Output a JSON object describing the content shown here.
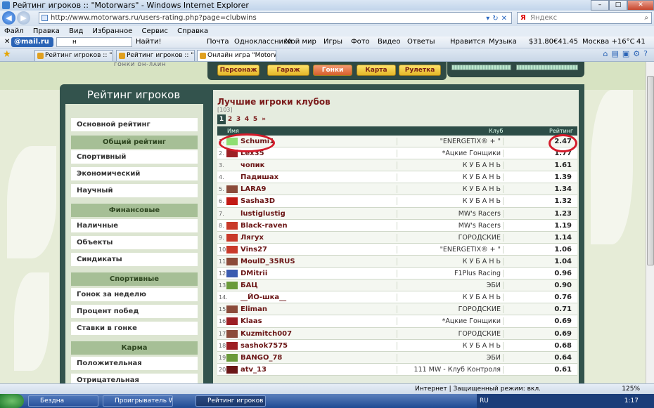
{
  "window": {
    "title": "Рейтинг игроков :: \"Motorwars\" - Windows Internet Explorer"
  },
  "address": {
    "url": "http://www.motorwars.ru/users-rating.php?page=clubwins",
    "search_placeholder": "Яндекс"
  },
  "menu": [
    "Файл",
    "Правка",
    "Вид",
    "Избранное",
    "Сервис",
    "Справка"
  ],
  "toolbar": {
    "close": "✕",
    "brand": "@mail.ru",
    "search_value": "н",
    "find": "Найти!",
    "items": [
      "Почта",
      "Одноклассники",
      "Мой мир",
      "Игры",
      "Фото",
      "Видео",
      "Ответы",
      "Нравится",
      "Музыка"
    ],
    "usd": "31.80",
    "eur": "41.45",
    "weather": "Москва +16°C",
    "counter": "41"
  },
  "tabs": [
    {
      "label": "Рейтинг игроков :: \"Moto...\""
    },
    {
      "label": "Рейтинг игроков :: \"M...\""
    },
    {
      "label": "Онлайн игра \"Motorwars\""
    }
  ],
  "site": {
    "logo_sub": "ГОНКИ ОН-ЛАЙН",
    "nav": [
      "Персонаж",
      "Гараж",
      "Гонки",
      "Карта",
      "Рулетка"
    ],
    "active_nav": "Гонки",
    "progress": [
      0.55,
      0.45
    ]
  },
  "sidebar": {
    "title": "Рейтинг игроков",
    "main": "Основной рейтинг",
    "groups": [
      {
        "title": "Общий рейтинг",
        "items": [
          "Спортивный",
          "Экономический",
          "Научный"
        ]
      },
      {
        "title": "Финансовые",
        "items": [
          "Наличные",
          "Объекты",
          "Синдикаты"
        ]
      },
      {
        "title": "Спортивные",
        "items": [
          "Гонок за неделю",
          "Процент побед",
          "Ставки в гонке"
        ]
      },
      {
        "title": "Карма",
        "items": [
          "Положительная",
          "Отрицательная"
        ]
      }
    ]
  },
  "rating": {
    "title": "Лучшие игроки клубов",
    "count": "[103]",
    "pages": [
      "1",
      "2",
      "3",
      "4",
      "5",
      "»"
    ],
    "current_page": "1",
    "columns": {
      "name": "Имя",
      "club": "Клуб",
      "rating": "Рейтинг"
    },
    "rows": [
      {
        "rank": "1.",
        "name": "Schumi1",
        "club": "\"ENERGETIX® + \"",
        "rating": "2.47",
        "icon": "#8ede72"
      },
      {
        "rank": "2.",
        "name": "Lex35",
        "club": "*Ацкие Гонщики",
        "rating": "1.77",
        "icon": "#9c1f24"
      },
      {
        "rank": "3.",
        "name": "чопик",
        "club": "К У Б А Н Ь",
        "rating": "1.61",
        "icon": ""
      },
      {
        "rank": "4.",
        "name": "Падишах",
        "club": "К У Б А Н Ь",
        "rating": "1.39",
        "icon": ""
      },
      {
        "rank": "5.",
        "name": "LARA9",
        "club": "К У Б А Н Ь",
        "rating": "1.34",
        "icon": "#8b4b3a"
      },
      {
        "rank": "6.",
        "name": "Sasha3D",
        "club": "К У Б А Н Ь",
        "rating": "1.32",
        "icon": "#c21a14"
      },
      {
        "rank": "7.",
        "name": "lustiglustig",
        "club": "MW's Racers",
        "rating": "1.23",
        "icon": ""
      },
      {
        "rank": "8.",
        "name": "Black-raven",
        "club": "MW's Racers",
        "rating": "1.19",
        "icon": "#c93a2a"
      },
      {
        "rank": "9.",
        "name": "Лягух",
        "club": "ГОРОДСКИЕ",
        "rating": "1.14",
        "icon": "#c93a2a"
      },
      {
        "rank": "10.",
        "name": "Vins27",
        "club": "\"ENERGETIX® + \"",
        "rating": "1.06",
        "icon": "#c93a2a"
      },
      {
        "rank": "11.",
        "name": "MoulD_35RUS",
        "club": "К У Б А Н Ь",
        "rating": "1.04",
        "icon": "#8b4b3a"
      },
      {
        "rank": "12.",
        "name": "DMitrii",
        "club": "F1Plus Racing",
        "rating": "0.96",
        "icon": "#3a5bb0"
      },
      {
        "rank": "13.",
        "name": "БАЦ",
        "club": "ЭБИ",
        "rating": "0.90",
        "icon": "#6a9a3a"
      },
      {
        "rank": "14.",
        "name": "__ЙО-шка__",
        "club": "К У Б А Н Ь",
        "rating": "0.76",
        "icon": ""
      },
      {
        "rank": "15.",
        "name": "Eliman",
        "club": "ГОРОДСКИЕ",
        "rating": "0.71",
        "icon": "#8b4b3a"
      },
      {
        "rank": "16.",
        "name": "Klaas",
        "club": "*Ацкие Гонщики",
        "rating": "0.69",
        "icon": "#9c1f24"
      },
      {
        "rank": "17.",
        "name": "Kuzmitch007",
        "club": "ГОРОДСКИЕ",
        "rating": "0.69",
        "icon": "#8b4b3a"
      },
      {
        "rank": "18.",
        "name": "sashok7575",
        "club": "К У Б А Н Ь",
        "rating": "0.68",
        "icon": "#9c1f24"
      },
      {
        "rank": "19.",
        "name": "BANGO_78",
        "club": "ЭБИ",
        "rating": "0.64",
        "icon": "#6a9a3a"
      },
      {
        "rank": "20.",
        "name": "atv_13",
        "club": "111 MW - Клуб Контроля",
        "rating": "0.61",
        "icon": "#6a1515"
      }
    ]
  },
  "status": {
    "zone": "Интернет | Защищенный режим: вкл.",
    "zoom": "125%"
  },
  "taskbar": {
    "tasks": [
      "Бездна",
      "Проигрыватель Win...",
      "Рейтинг игроков :: \"...\""
    ],
    "lang": "RU",
    "time": "1:17"
  },
  "colors": {
    "accent": "#33534d",
    "highlight": "#d41b2a",
    "link": "#6a1515"
  }
}
